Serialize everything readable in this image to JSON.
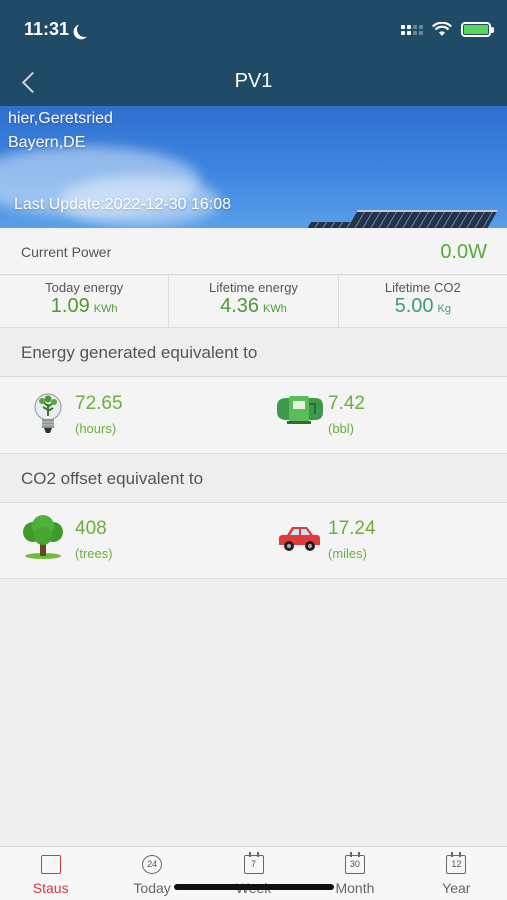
{
  "status_bar": {
    "time": "11:31"
  },
  "nav": {
    "title": "PV1"
  },
  "banner": {
    "location_line1": "hier,Geretsried",
    "location_line2": "Bayern,DE",
    "last_update": "Last Update:2022-12-30 16:08"
  },
  "current_power": {
    "label": "Current Power",
    "value": "0.0W"
  },
  "stats": [
    {
      "label": "Today energy",
      "value": "1.09",
      "unit": "KWh"
    },
    {
      "label": "Lifetime energy",
      "value": "4.36",
      "unit": "KWh"
    },
    {
      "label": "Lifetime CO2",
      "value": "5.00",
      "unit": "Kg"
    }
  ],
  "energy_equivalent": {
    "heading": "Energy generated equivalent to",
    "items": [
      {
        "icon": "light-bulb-icon",
        "value": "72.65",
        "unit": "(hours)"
      },
      {
        "icon": "fuel-pump-icon",
        "value": "7.42",
        "unit": "(bbl)"
      }
    ]
  },
  "co2_equivalent": {
    "heading": "CO2 offset equivalent to",
    "items": [
      {
        "icon": "tree-icon",
        "value": "408",
        "unit": "(trees)"
      },
      {
        "icon": "car-icon",
        "value": "17.24",
        "unit": "(miles)"
      }
    ]
  },
  "tabs": [
    {
      "label": "Staus",
      "icon": "status-report-icon",
      "icon_text": "",
      "active": true
    },
    {
      "label": "Today",
      "icon": "24h-icon",
      "icon_text": "24",
      "active": false
    },
    {
      "label": "Week",
      "icon": "calendar-7-icon",
      "icon_text": "7",
      "active": false
    },
    {
      "label": "Month",
      "icon": "calendar-30-icon",
      "icon_text": "30",
      "active": false
    },
    {
      "label": "Year",
      "icon": "calendar-12-icon",
      "icon_text": "12",
      "active": false
    }
  ],
  "colors": {
    "header": "#1f4b66",
    "value_green": "#4e9a35",
    "active_tab": "#d23a3a"
  }
}
